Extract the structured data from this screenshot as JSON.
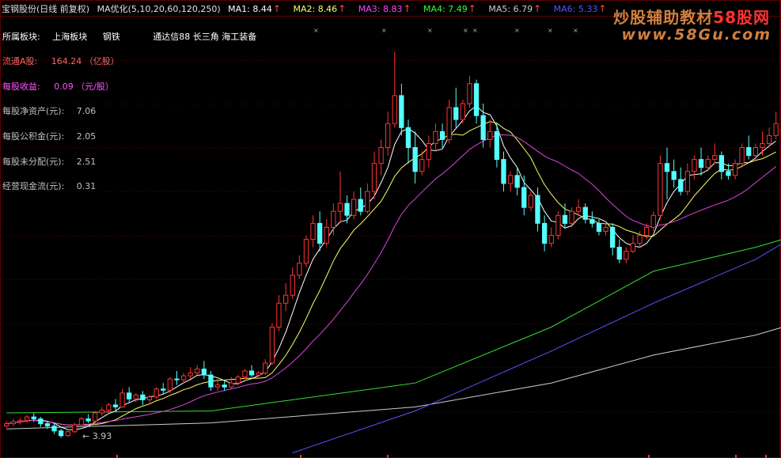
{
  "header": {
    "title": "宝钢股份(日线 前复权)",
    "indicator": "MA优化(5,10,20,60,120,250)",
    "ma": [
      {
        "label": "MA1:",
        "value": "8.44",
        "color": "#ffffff"
      },
      {
        "label": "MA2:",
        "value": "8.46",
        "color": "#ffff66"
      },
      {
        "label": "MA3:",
        "value": "8.83",
        "color": "#ff44ff"
      },
      {
        "label": "MA4:",
        "value": "7.49",
        "color": "#33ff33"
      },
      {
        "label": "MA5:",
        "value": "6.79",
        "color": "#cccccc"
      },
      {
        "label": "MA6:",
        "value": "5.33",
        "color": "#5555ff"
      }
    ],
    "arrow": "↑",
    "arrow_color": "#ff4444"
  },
  "watermark": {
    "line1": "炒股辅助教材",
    "line1_suffix": "58股网",
    "line2": "www.58Gu.com",
    "colors": {
      "main": "#d08040",
      "suffix": "#ff3333"
    }
  },
  "info": {
    "sector_label": "所属板块:",
    "sector_values": [
      "上海板块",
      "钢铁",
      "通达信88 长三角 海工装备"
    ],
    "float_shares_label": "流通A股:",
    "float_shares_value": "164.24 （亿股）",
    "eps_label": "每股收益:",
    "eps_value": "0.09 （元/股）",
    "nav_label": "每股净资产(元):",
    "nav_value": "7.06",
    "reserve_label": "每股公积金(元):",
    "reserve_value": "2.05",
    "undistributed_label": "每股未分配(元):",
    "undistributed_value": "2.51",
    "cashflow_label": "经营现金流(元):",
    "cashflow_value": "0.31"
  },
  "low_price_label": "3.93",
  "colors": {
    "up": "#ff3333",
    "down": "#54ffff",
    "grid": "#5a0000",
    "text_red": "#ff6666",
    "text_white": "#ffffff",
    "text_gray": "#c0c0c0",
    "text_yellow": "#ffff99",
    "text_magenta": "#ff55ff"
  },
  "chart_data": {
    "type": "candlestick",
    "ylim": [
      3.5,
      14.5
    ],
    "candles": [
      [
        4.22,
        4.35,
        4.28,
        4.18
      ],
      [
        4.28,
        4.4,
        4.33,
        4.22
      ],
      [
        4.33,
        4.42,
        4.36,
        4.26
      ],
      [
        4.36,
        4.5,
        4.45,
        4.3
      ],
      [
        4.45,
        4.55,
        4.4,
        4.32
      ],
      [
        4.4,
        4.45,
        4.28,
        4.2
      ],
      [
        4.28,
        4.35,
        4.22,
        4.15
      ],
      [
        4.22,
        4.28,
        4.1,
        4.02
      ],
      [
        4.1,
        4.15,
        3.98,
        3.93
      ],
      [
        3.98,
        4.15,
        4.08,
        3.95
      ],
      [
        4.08,
        4.3,
        4.25,
        4.05
      ],
      [
        4.25,
        4.45,
        4.4,
        4.2
      ],
      [
        4.4,
        4.52,
        4.35,
        4.3
      ],
      [
        4.35,
        4.6,
        4.55,
        4.3
      ],
      [
        4.55,
        4.7,
        4.62,
        4.48
      ],
      [
        4.62,
        4.8,
        4.75,
        4.55
      ],
      [
        4.75,
        4.9,
        4.7,
        4.6
      ],
      [
        4.7,
        5.15,
        5.05,
        4.68
      ],
      [
        5.05,
        5.2,
        4.9,
        4.8
      ],
      [
        4.9,
        5.05,
        5.0,
        4.82
      ],
      [
        5.0,
        5.1,
        4.88,
        4.75
      ],
      [
        4.88,
        5.0,
        4.95,
        4.8
      ],
      [
        4.95,
        5.2,
        5.15,
        4.9
      ],
      [
        5.15,
        5.3,
        5.12,
        5.02
      ],
      [
        5.12,
        5.45,
        5.4,
        5.05
      ],
      [
        5.4,
        5.6,
        5.38,
        5.25
      ],
      [
        5.38,
        5.55,
        5.48,
        5.3
      ],
      [
        5.48,
        5.7,
        5.55,
        5.4
      ],
      [
        5.55,
        5.75,
        5.65,
        5.5
      ],
      [
        5.65,
        5.85,
        5.5,
        5.4
      ],
      [
        5.5,
        5.6,
        5.2,
        5.1
      ],
      [
        5.2,
        5.4,
        5.25,
        5.1
      ],
      [
        5.25,
        5.35,
        5.2,
        5.1
      ],
      [
        5.2,
        5.45,
        5.3,
        5.15
      ],
      [
        5.3,
        5.5,
        5.45,
        5.25
      ],
      [
        5.45,
        5.65,
        5.6,
        5.4
      ],
      [
        5.6,
        5.75,
        5.5,
        5.45
      ],
      [
        5.5,
        5.6,
        5.55,
        5.45
      ],
      [
        5.55,
        5.9,
        5.8,
        5.5
      ],
      [
        5.8,
        6.8,
        6.7,
        5.75
      ],
      [
        6.7,
        7.5,
        7.3,
        6.6
      ],
      [
        7.3,
        7.8,
        7.5,
        7.1
      ],
      [
        7.5,
        8.2,
        8.0,
        7.4
      ],
      [
        8.0,
        8.5,
        8.3,
        7.9
      ],
      [
        8.3,
        9.0,
        8.9,
        8.2
      ],
      [
        8.9,
        9.5,
        9.3,
        8.7
      ],
      [
        9.3,
        9.6,
        8.8,
        8.6
      ],
      [
        8.8,
        9.4,
        9.2,
        8.7
      ],
      [
        9.2,
        9.8,
        9.6,
        9.0
      ],
      [
        9.6,
        10.6,
        9.8,
        9.3
      ],
      [
        9.8,
        10.0,
        9.5,
        9.3
      ],
      [
        9.5,
        10.1,
        9.9,
        9.4
      ],
      [
        9.9,
        10.2,
        9.6,
        9.5
      ],
      [
        9.6,
        10.3,
        10.1,
        9.55
      ],
      [
        10.1,
        11.1,
        10.8,
        9.9
      ],
      [
        10.8,
        11.4,
        11.2,
        10.5
      ],
      [
        11.2,
        12.1,
        11.8,
        11.0
      ],
      [
        11.8,
        13.6,
        12.5,
        11.7
      ],
      [
        12.5,
        12.8,
        11.7,
        11.5
      ],
      [
        11.7,
        11.9,
        11.2,
        10.8
      ],
      [
        11.2,
        11.6,
        10.6,
        10.3
      ],
      [
        10.6,
        11.1,
        10.9,
        10.5
      ],
      [
        10.9,
        11.5,
        11.3,
        10.7
      ],
      [
        11.3,
        11.8,
        11.6,
        11.1
      ],
      [
        11.6,
        11.8,
        11.4,
        11.2
      ],
      [
        11.4,
        12.4,
        12.2,
        11.3
      ],
      [
        12.2,
        12.7,
        11.9,
        11.7
      ],
      [
        11.9,
        12.4,
        12.3,
        11.8
      ],
      [
        12.3,
        13.0,
        12.8,
        12.2
      ],
      [
        12.8,
        12.9,
        12.0,
        11.8
      ],
      [
        12.0,
        12.3,
        11.4,
        11.2
      ],
      [
        11.4,
        11.9,
        11.6,
        11.2
      ],
      [
        11.6,
        11.8,
        10.9,
        10.7
      ],
      [
        10.9,
        11.1,
        10.3,
        10.1
      ],
      [
        10.3,
        10.6,
        10.5,
        10.1
      ],
      [
        10.5,
        10.7,
        10.2,
        10.0
      ],
      [
        10.2,
        10.5,
        9.7,
        9.5
      ],
      [
        9.7,
        10.1,
        10.0,
        9.6
      ],
      [
        10.0,
        10.2,
        9.3,
        9.1
      ],
      [
        9.3,
        9.5,
        8.8,
        8.6
      ],
      [
        8.8,
        9.2,
        9.0,
        8.7
      ],
      [
        9.0,
        9.6,
        9.5,
        8.9
      ],
      [
        9.5,
        9.8,
        9.3,
        9.2
      ],
      [
        9.3,
        9.7,
        9.6,
        9.2
      ],
      [
        9.6,
        9.9,
        9.7,
        9.5
      ],
      [
        9.7,
        9.8,
        9.4,
        9.3
      ],
      [
        9.4,
        9.6,
        9.3,
        9.2
      ],
      [
        9.3,
        9.4,
        9.1,
        9.0
      ],
      [
        9.1,
        9.3,
        9.2,
        9.0
      ],
      [
        9.2,
        9.3,
        8.7,
        8.5
      ],
      [
        8.7,
        8.9,
        8.4,
        8.3
      ],
      [
        8.4,
        8.7,
        8.6,
        8.3
      ],
      [
        8.6,
        9.0,
        8.8,
        8.55
      ],
      [
        8.8,
        9.1,
        9.0,
        8.7
      ],
      [
        9.0,
        9.3,
        9.2,
        8.9
      ],
      [
        9.2,
        9.6,
        9.5,
        9.1
      ],
      [
        9.5,
        11.0,
        10.8,
        9.4
      ],
      [
        10.8,
        11.2,
        10.6,
        9.9
      ],
      [
        10.6,
        10.9,
        10.4,
        10.2
      ],
      [
        10.4,
        10.7,
        10.1,
        10.0
      ],
      [
        10.1,
        10.8,
        10.6,
        10.0
      ],
      [
        10.6,
        11.0,
        10.9,
        10.4
      ],
      [
        10.9,
        11.2,
        10.7,
        10.5
      ],
      [
        10.7,
        11.0,
        10.9,
        10.6
      ],
      [
        10.9,
        11.3,
        11.0,
        10.8
      ],
      [
        11.0,
        11.1,
        10.6,
        10.4
      ],
      [
        10.6,
        10.8,
        10.5,
        10.4
      ],
      [
        10.5,
        10.9,
        10.8,
        10.4
      ],
      [
        10.8,
        11.3,
        11.2,
        10.7
      ],
      [
        11.2,
        11.5,
        11.0,
        10.9
      ],
      [
        11.0,
        11.3,
        11.2,
        10.9
      ],
      [
        11.2,
        11.6,
        11.3,
        11.0
      ],
      [
        11.3,
        11.7,
        11.5,
        11.2
      ],
      [
        11.5,
        12.1,
        11.8,
        11.4
      ]
    ],
    "ma_series": [
      {
        "name": "MA4",
        "color": "#33dd33",
        "points": [
          [
            0,
            4.55
          ],
          [
            30,
            4.6
          ],
          [
            60,
            5.3
          ],
          [
            80,
            6.7
          ],
          [
            95,
            8.1
          ],
          [
            110,
            8.7
          ],
          [
            114,
            8.9
          ]
        ]
      },
      {
        "name": "MA5",
        "color": "#cccccc",
        "points": [
          [
            0,
            4.15
          ],
          [
            30,
            4.3
          ],
          [
            60,
            4.7
          ],
          [
            80,
            5.3
          ],
          [
            95,
            6.0
          ],
          [
            110,
            6.5
          ],
          [
            114,
            6.7
          ]
        ]
      },
      {
        "name": "MA6",
        "color": "#5555ff",
        "points": [
          [
            42,
            3.55
          ],
          [
            60,
            4.6
          ],
          [
            80,
            6.1
          ],
          [
            95,
            7.3
          ],
          [
            110,
            8.4
          ],
          [
            114,
            8.8
          ]
        ]
      }
    ]
  }
}
